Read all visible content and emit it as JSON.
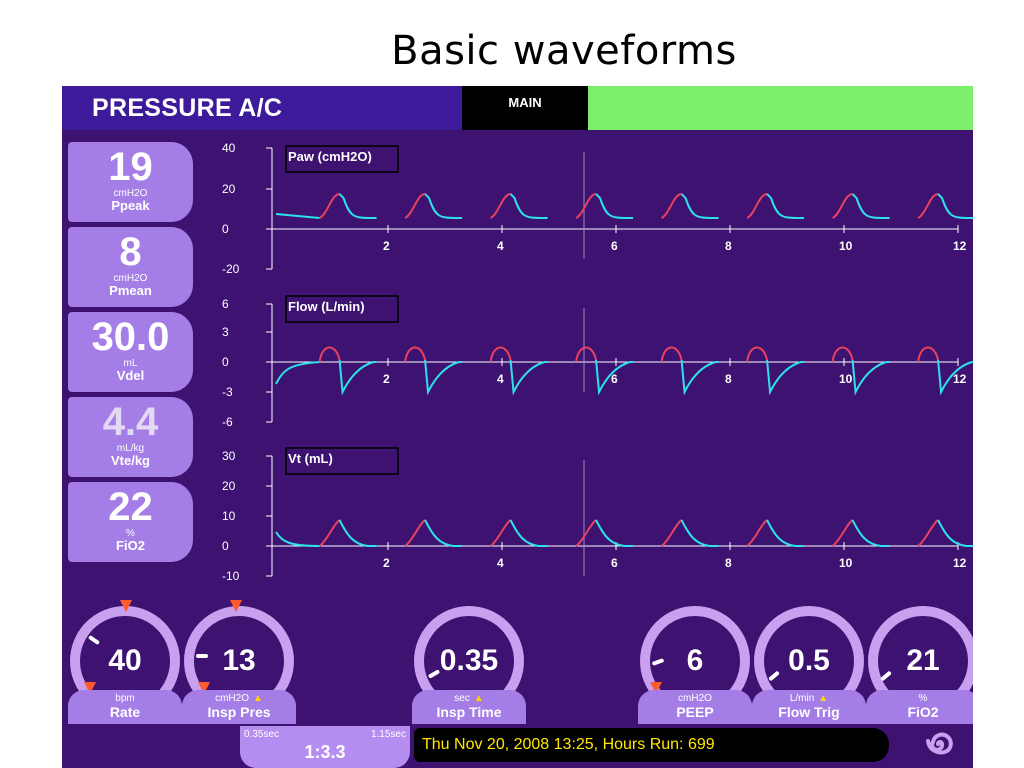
{
  "slide_title": "Basic waveforms",
  "header": {
    "mode": "PRESSURE A/C",
    "tab_main": "MAIN",
    "alarm_bar_color": "#7cf06a"
  },
  "monitors": [
    {
      "value": "19",
      "unit": "cmH2O",
      "label": "Ppeak",
      "pale": false
    },
    {
      "value": "8",
      "unit": "cmH2O",
      "label": "Pmean",
      "pale": false
    },
    {
      "value": "30.0",
      "unit": "mL",
      "label": "Vdel",
      "pale": false
    },
    {
      "value": "4.4",
      "unit": "mL/kg",
      "label": "Vte/kg",
      "pale": true
    },
    {
      "value": "22",
      "unit": "%",
      "label": "FiO2",
      "pale": false
    }
  ],
  "graphs": [
    {
      "label": "Paw (cmH2O)",
      "yticks": [
        "40",
        "20",
        "0",
        "-20"
      ],
      "xticks": [
        "2",
        "4",
        "6",
        "8",
        "10",
        "12"
      ]
    },
    {
      "label": "Flow (L/min)",
      "yticks": [
        "6",
        "3",
        "0",
        "-3",
        "-6"
      ],
      "xticks": [
        "2",
        "4",
        "6",
        "8",
        "10",
        "12"
      ]
    },
    {
      "label": "Vt (mL)",
      "yticks": [
        "30",
        "20",
        "10",
        "0",
        "-10"
      ],
      "xticks": [
        "2",
        "4",
        "6",
        "8",
        "10",
        "12"
      ]
    }
  ],
  "waveform_colors": {
    "inspiration": "#e8425e",
    "expiration": "#2ee0ea"
  },
  "settings": [
    {
      "value": "40",
      "unit": "bpm",
      "label": "Rate",
      "warning": false
    },
    {
      "value": "13",
      "unit": "cmH2O",
      "label": "Insp Pres",
      "warning": true
    },
    {
      "value": "0.35",
      "unit": "sec",
      "label": "Insp Time",
      "warning": true
    },
    {
      "value": "6",
      "unit": "cmH2O",
      "label": "PEEP",
      "warning": false
    },
    {
      "value": "0.5",
      "unit": "L/min",
      "label": "Flow Trig",
      "warning": true
    },
    {
      "value": "21",
      "unit": "%",
      "label": "FiO2",
      "warning": false
    }
  ],
  "ie": {
    "min": "0.35sec",
    "max": "1.15sec",
    "ratio": "1:3.3"
  },
  "status": {
    "text": "Thu Nov 20, 2008 13:25, Hours Run:   699"
  },
  "icons": {
    "logo": "spiral-logo-icon",
    "warning": "warning-triangle-icon"
  }
}
